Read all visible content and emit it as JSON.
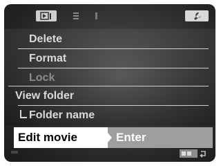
{
  "menu": {
    "items": [
      {
        "label": "Delete"
      },
      {
        "label": "Format"
      },
      {
        "label": "Lock"
      },
      {
        "label": "View folder"
      },
      {
        "label": "Folder name"
      }
    ],
    "selected": {
      "label": "Edit movie",
      "value": "Enter"
    }
  },
  "icons": {
    "tab_play": "playback-icon",
    "tab_setup": "wrench-icon",
    "bottom": "menu-back-icon"
  },
  "colors": {
    "selected_bg": "#ffffff",
    "selected_value_bg": "#9e9e9e",
    "text": "#d9d9d9"
  }
}
